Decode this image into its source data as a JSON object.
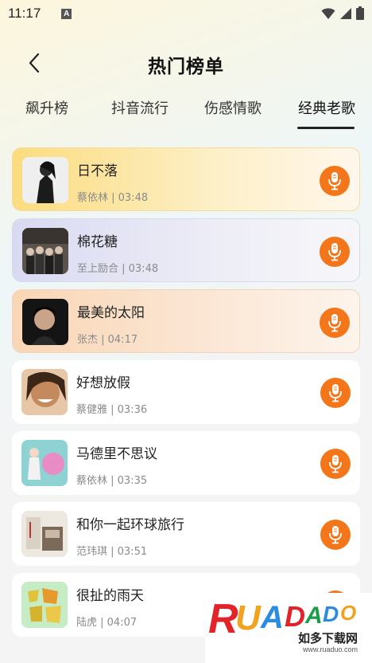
{
  "status": {
    "time": "11:17",
    "notification_icon": "a-app-icon",
    "icons": [
      "wifi-icon",
      "signal-icon",
      "battery-icon"
    ]
  },
  "header": {
    "title": "热门榜单",
    "back_icon": "chevron-left-icon"
  },
  "tabs": [
    {
      "label": "飙升榜",
      "active": false
    },
    {
      "label": "抖音流行",
      "active": false
    },
    {
      "label": "伤感情歌",
      "active": false
    },
    {
      "label": "经典老歌",
      "active": true
    }
  ],
  "songs": [
    {
      "title": "日不落",
      "meta": "蔡依林 | 03:48",
      "cover_color": "#1b1b1b"
    },
    {
      "title": "棉花糖",
      "meta": "至上励合 | 03:48",
      "cover_color": "#4a4440"
    },
    {
      "title": "最美的太阳",
      "meta": "张杰 | 04:17",
      "cover_color": "#111111"
    },
    {
      "title": "好想放假",
      "meta": "蔡健雅 | 03:36",
      "cover_color": "#c9895c"
    },
    {
      "title": "马德里不思议",
      "meta": "蔡依林 | 03:35",
      "cover_color": "#7fc5c9"
    },
    {
      "title": "和你一起环球旅行",
      "meta": "范玮琪 | 03:51",
      "cover_color": "#e8e3da"
    },
    {
      "title": "很扯的雨天",
      "meta": "陆虎 | 04:07",
      "cover_color": "#bfe8c0"
    }
  ],
  "colors": {
    "accent": "#f4761a",
    "highlight_1": "#fbdc7e",
    "highlight_2": "#d9daf2",
    "highlight_3": "#f9d6b5"
  },
  "watermark": {
    "logo": "RUANDAO",
    "subtitle": "如多下载网",
    "url": "www.ruaduo.com"
  }
}
